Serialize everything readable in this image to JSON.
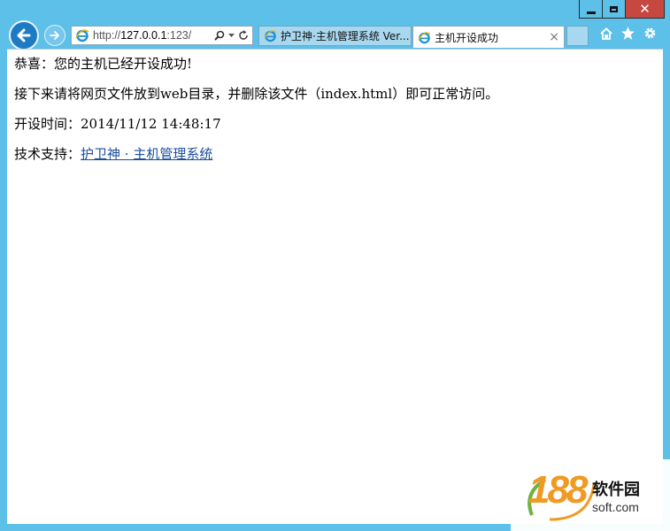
{
  "browser": {
    "address": {
      "prefix": "http://",
      "host": "127.0.0.1",
      "suffix": ":123/"
    },
    "tabs": [
      {
        "label": "护卫神·主机管理系统 Ver...",
        "active": false
      },
      {
        "label": "主机开设成功",
        "active": true
      }
    ],
    "close_glyph": "×",
    "window_close": "✕"
  },
  "content": {
    "line1": "恭喜：您的主机已经开设成功!",
    "line2": "接下来请将网页文件放到web目录，并删除该文件（index.html）即可正常访问。",
    "time_label": "开设时间：",
    "time_value": "2014/11/12 14:48:17",
    "support_label": "技术支持：",
    "support_link": "护卫神 · 主机管理系统"
  },
  "watermark": {
    "number": "188",
    "cn": "软件园",
    "en": "soft.com"
  },
  "colors": {
    "chrome": "#5cc0e8",
    "close": "#c74741",
    "link": "#1a4f9c"
  }
}
